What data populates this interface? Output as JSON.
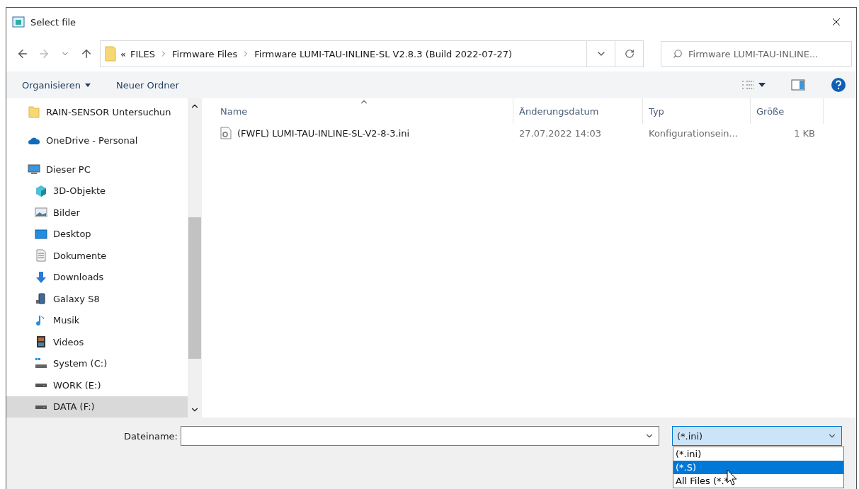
{
  "window": {
    "title": "Select file"
  },
  "address_bar": {
    "overflow": "«",
    "crumbs": [
      "FILES",
      "Firmware Files",
      "Firmware LUMI-TAU-INLINE-SL V2.8.3 (Build 2022-07-27)"
    ]
  },
  "search": {
    "placeholder": "Firmware LUMI-TAU-INLINE..."
  },
  "toolbar": {
    "organize": "Organisieren",
    "new_folder": "Neuer Ordner"
  },
  "sidebar": {
    "items": [
      {
        "label": "RAIN-SENSOR Untersuchun",
        "kind": "folder",
        "selected": false
      },
      {
        "label": "OneDrive - Personal",
        "kind": "cloud",
        "selected": false
      },
      {
        "label": "Dieser PC",
        "kind": "pc",
        "selected": false,
        "children": [
          {
            "label": "3D-Objekte",
            "kind": "cube",
            "selected": false
          },
          {
            "label": "Bilder",
            "kind": "pictures",
            "selected": false
          },
          {
            "label": "Desktop",
            "kind": "desktop",
            "selected": false
          },
          {
            "label": "Dokumente",
            "kind": "documents",
            "selected": false
          },
          {
            "label": "Downloads",
            "kind": "downloads",
            "selected": false
          },
          {
            "label": "Galaxy S8",
            "kind": "phone",
            "selected": false
          },
          {
            "label": "Musik",
            "kind": "music",
            "selected": false
          },
          {
            "label": "Videos",
            "kind": "videos",
            "selected": false
          },
          {
            "label": "System (C:)",
            "kind": "system-drive",
            "selected": false
          },
          {
            "label": "WORK (E:)",
            "kind": "drive",
            "selected": false
          },
          {
            "label": "DATA (F:)",
            "kind": "drive",
            "selected": true
          }
        ]
      }
    ]
  },
  "table": {
    "columns": [
      "Name",
      "Änderungsdatum",
      "Typ",
      "Größe"
    ],
    "rows": [
      {
        "name": "(FWFL) LUMI-TAU-INLINE-SL-V2-8-3.ini",
        "date": "27.07.2022 14:03",
        "type": "Konfigurationsein...",
        "size": "1 KB",
        "selected": false
      }
    ]
  },
  "footer": {
    "filename_label": "Dateiname:",
    "filetype": "(*.ini)",
    "filetype_options": [
      {
        "label": "(*.ini)",
        "selected": false
      },
      {
        "label": "(*.S)",
        "selected": true
      },
      {
        "label": "All Files (*.*",
        "selected": false
      }
    ]
  }
}
